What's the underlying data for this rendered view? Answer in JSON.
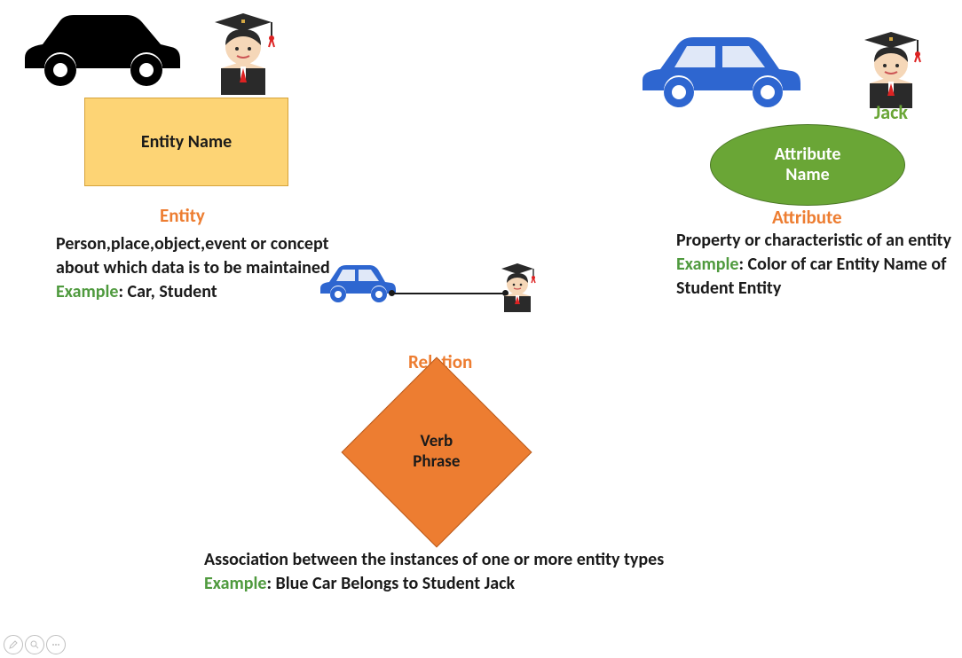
{
  "entity": {
    "shape_label": "Entity Name",
    "title": "Entity",
    "description": "Person,place,object,event or concept about which data is to be maintained",
    "example_label": "Example",
    "example_text": ": Car, Student"
  },
  "relation": {
    "shape_label_line1": "Verb",
    "shape_label_line2": "Phrase",
    "title": "Relation",
    "description": "Association between the instances of one or more entity types",
    "example_label": "Example",
    "example_text": ": Blue Car Belongs to Student Jack"
  },
  "attribute": {
    "shape_label_line1": "Attribute",
    "shape_label_line2": "Name",
    "title": "Attribute",
    "name_label": "Jack",
    "description": "Property or characteristic of an entity",
    "example_label": "Example",
    "example_text": ": Color of car Entity Name of Student Entity"
  },
  "icons": {
    "car_black": "car-icon",
    "car_blue": "car-icon",
    "student": "student-icon"
  }
}
